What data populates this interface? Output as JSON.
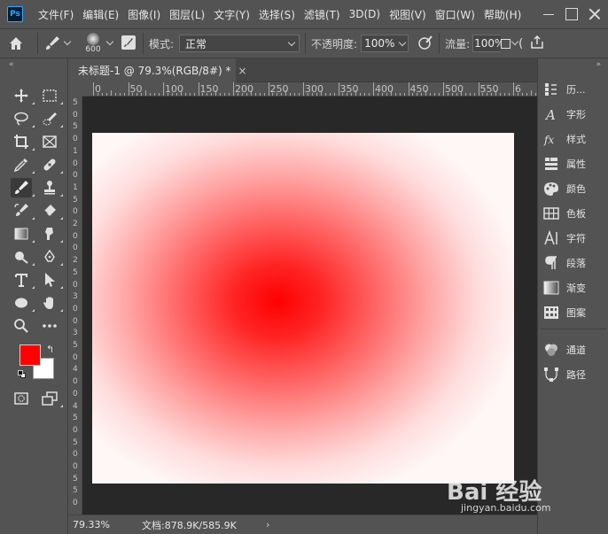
{
  "app": {
    "logo_text": "Ps"
  },
  "menu": [
    "文件(F)",
    "编辑(E)",
    "图像(I)",
    "图层(L)",
    "文字(Y)",
    "选择(S)",
    "滤镜(T)",
    "3D(D)",
    "视图(V)",
    "窗口(W)",
    "帮助(H)"
  ],
  "options": {
    "brush_size": "600",
    "mode_label": "模式:",
    "mode_value": "正常",
    "opacity_label": "不透明度:",
    "opacity_value": "100%",
    "flow_label": "流量:",
    "flow_value": "100%"
  },
  "document": {
    "tab_title": "未标题-1 @ 79.3%(RGB/8#) *",
    "tab_close": "×",
    "gradient_color": "#ff0000"
  },
  "rulers": {
    "horizontal": [
      "0",
      "50",
      "100",
      "150",
      "200",
      "250",
      "300",
      "350",
      "400",
      "450",
      "500",
      "550",
      "6"
    ],
    "vertical": [
      "5",
      "0",
      "5",
      "0",
      "1",
      "0",
      "0",
      "1",
      "5",
      "0",
      "2",
      "0",
      "0",
      "2",
      "5",
      "0",
      "3",
      "0",
      "0",
      "3",
      "5",
      "0",
      "4",
      "0",
      "0",
      "4",
      "5",
      "0",
      "5",
      "0",
      "0",
      "5",
      "5",
      "0"
    ]
  },
  "status": {
    "zoom": "79.33%",
    "doc_info": "文档:878.9K/585.9K",
    "arrow": "›"
  },
  "colors": {
    "foreground": "#ff0000",
    "background": "#ffffff"
  },
  "right_panel": [
    {
      "label": "历...",
      "icon": "history-icon"
    },
    {
      "label": "字形",
      "icon": "glyphs-icon"
    },
    {
      "label": "样式",
      "icon": "styles-icon"
    },
    {
      "label": "属性",
      "icon": "properties-icon"
    },
    {
      "label": "颜色",
      "icon": "color-icon"
    },
    {
      "label": "色板",
      "icon": "swatches-icon"
    },
    {
      "label": "字符",
      "icon": "character-icon"
    },
    {
      "label": "段落",
      "icon": "paragraph-icon"
    },
    {
      "label": "渐变",
      "icon": "gradient-icon"
    },
    {
      "label": "图案",
      "icon": "pattern-icon"
    },
    {
      "label": "通道",
      "icon": "channels-icon"
    },
    {
      "label": "路径",
      "icon": "paths-icon"
    }
  ],
  "watermark": {
    "text": "Bai 经验",
    "sub": "jingyan.baidu.com"
  }
}
